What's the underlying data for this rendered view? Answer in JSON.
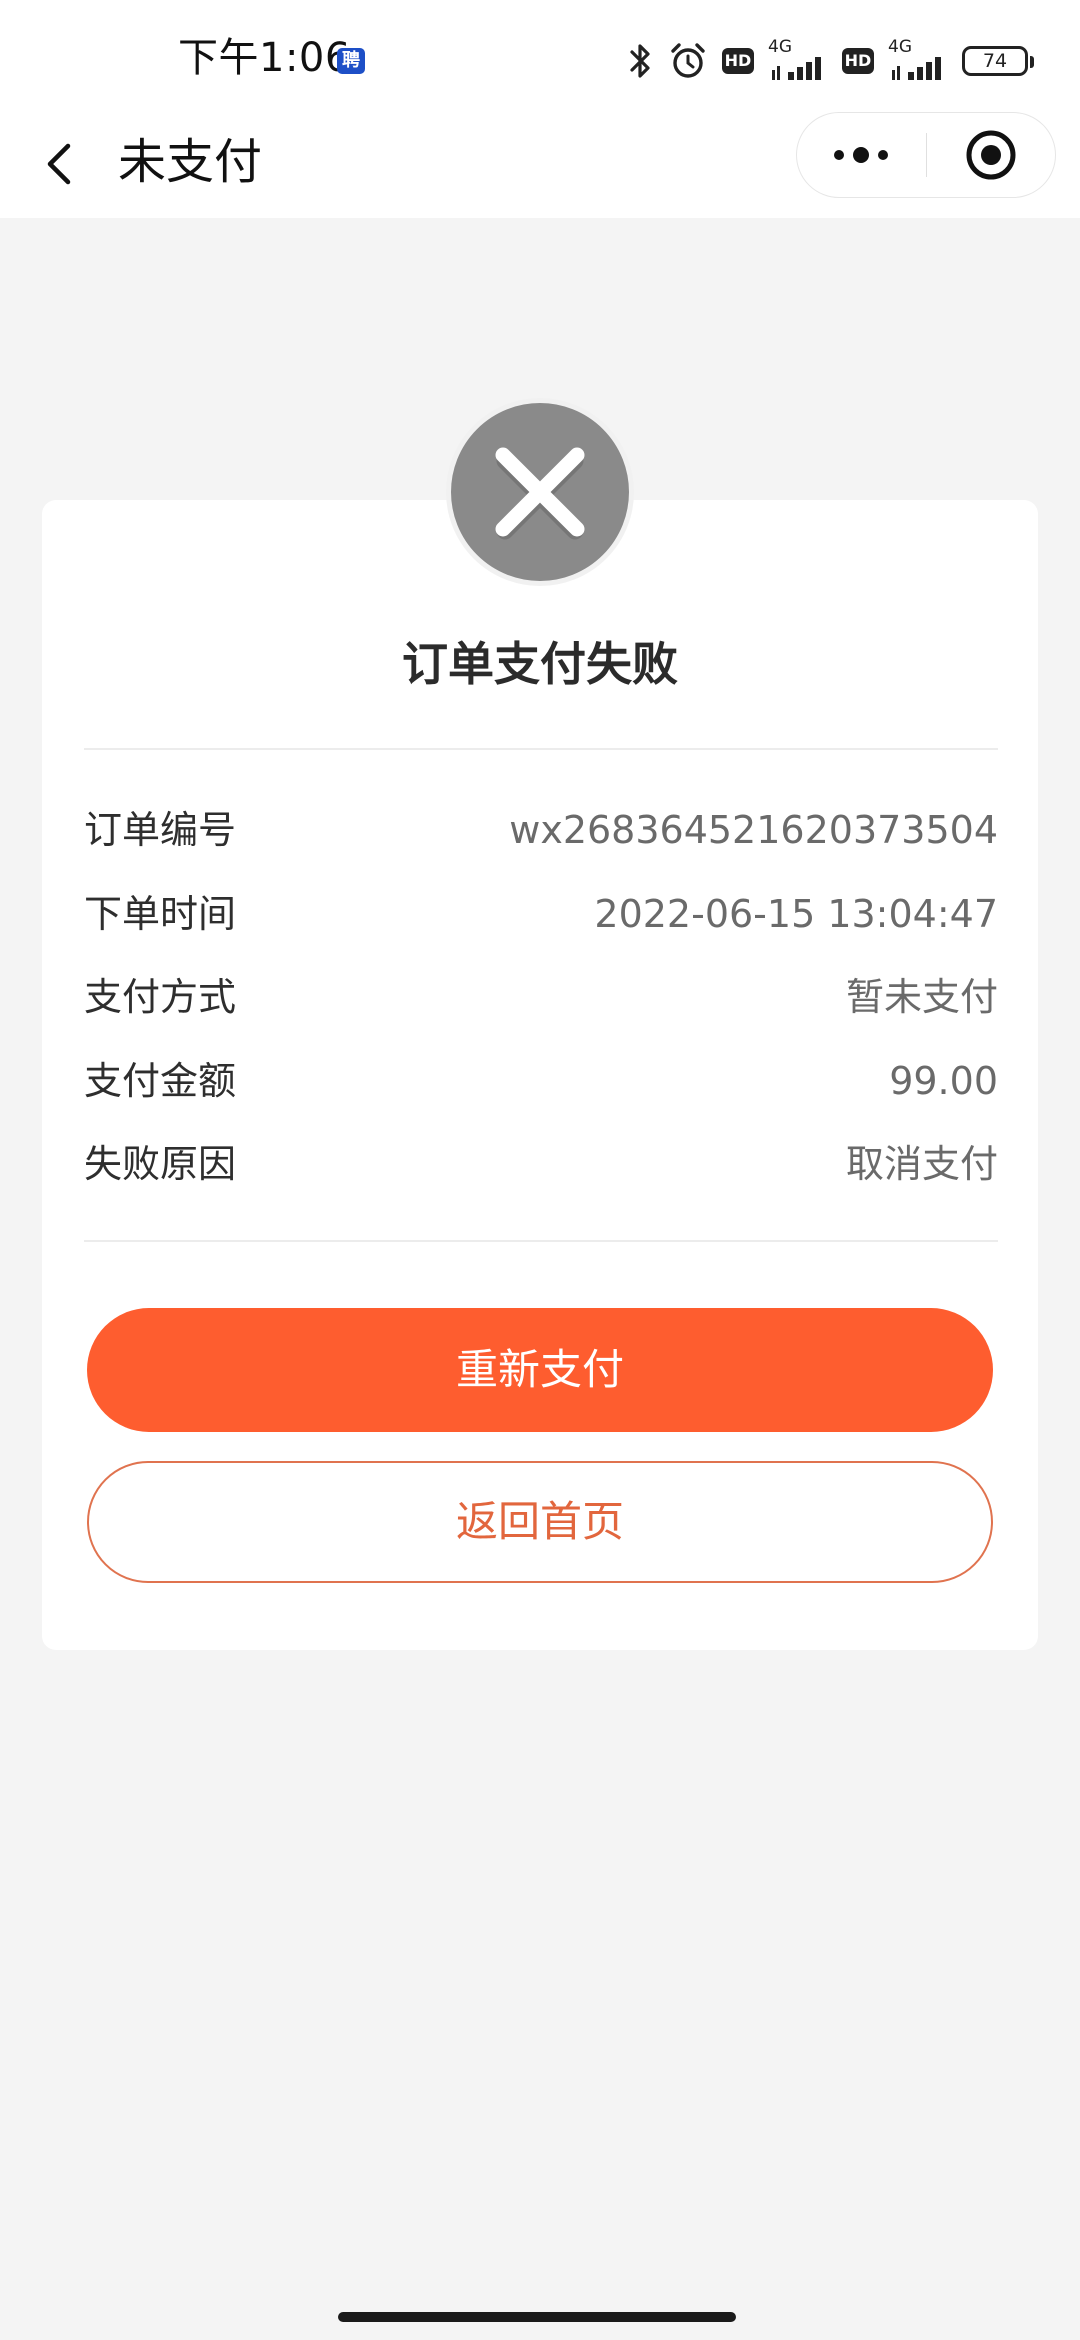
{
  "status_bar": {
    "time": "下午1:06",
    "app_badge": "聘",
    "hd_label": "HD",
    "network_label": "4G",
    "battery": "74",
    "icons": [
      "bluetooth-icon",
      "alarm-icon",
      "hd-icon",
      "signal-icon",
      "battery-icon"
    ]
  },
  "nav": {
    "title": "未支付",
    "back_icon": "chevron-left-icon",
    "more_icon": "more-dots-icon",
    "close_icon": "capsule-close-icon"
  },
  "result": {
    "icon": "close-circle-icon",
    "title": "订单支付失败"
  },
  "order_info": [
    {
      "label": "订单编号",
      "value": "wx268364521620373504"
    },
    {
      "label": "下单时间",
      "value": "2022-06-15 13:04:47"
    },
    {
      "label": "支付方式",
      "value": "暂未支付"
    },
    {
      "label": "支付金额",
      "value": "99.00"
    },
    {
      "label": "失败原因",
      "value": "取消支付"
    }
  ],
  "actions": {
    "retry_label": "重新支付",
    "home_label": "返回首页"
  },
  "colors": {
    "primary": "#fe5d2f",
    "secondary_border": "#e0734f",
    "background": "#f4f4f4",
    "fail_icon": "#8a8a8a"
  }
}
